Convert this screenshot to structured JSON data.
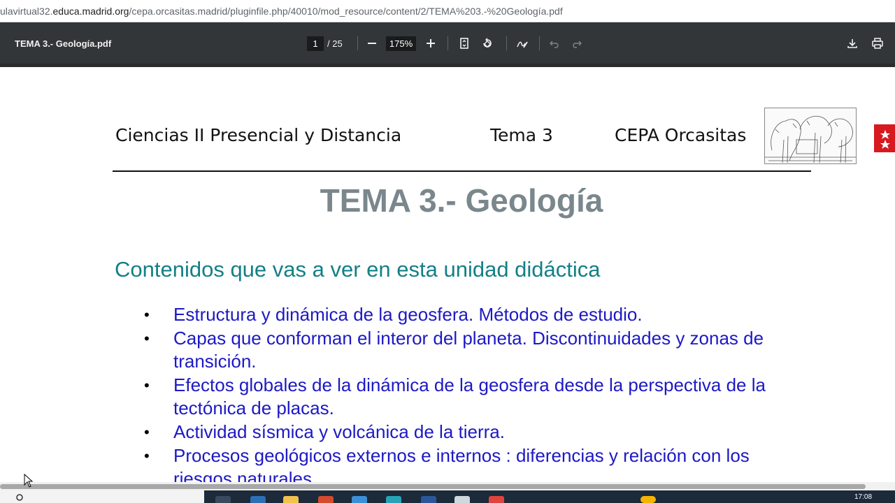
{
  "browser": {
    "url_prefix": "ulavirtual32.",
    "url_host": "educa.madrid.org",
    "url_path": "/cepa.orcasitas.madrid/pluginfile.php/40010/mod_resource/content/2/TEMA%203.-%20Geología.pdf"
  },
  "toolbar": {
    "doc_title": "TEMA 3.- Geología.pdf",
    "page_current": "1",
    "page_total": "/ 25",
    "zoom": "175%"
  },
  "document": {
    "header": {
      "course": "Ciencias II  Presencial y Distancia",
      "topic": "Tema 3",
      "center": "CEPA Orcasitas"
    },
    "title": "TEMA 3.- Geología",
    "subtitle": "Contenidos que vas a ver en esta unidad didáctica",
    "items": [
      "Estructura y dinámica de la geosfera. Métodos de estudio.",
      "Capas que conforman el interor del planeta. Discontinuidades y zonas de transición.",
      "Efectos globales de la dinámica de la geosfera desde la perspectiva de la tectónica de placas.",
      "Actividad sísmica y volcánica  de la tierra.",
      "Procesos geológicos externos e internos : diferencias y relación con los riesgos naturales."
    ],
    "bullet": "•"
  },
  "taskbar": {
    "clock": "17:08"
  },
  "colors": {
    "toolbar_bg": "#323639",
    "title_gray": "#7a878c",
    "subtitle_teal": "#138086",
    "list_blue": "#1d19c4"
  }
}
